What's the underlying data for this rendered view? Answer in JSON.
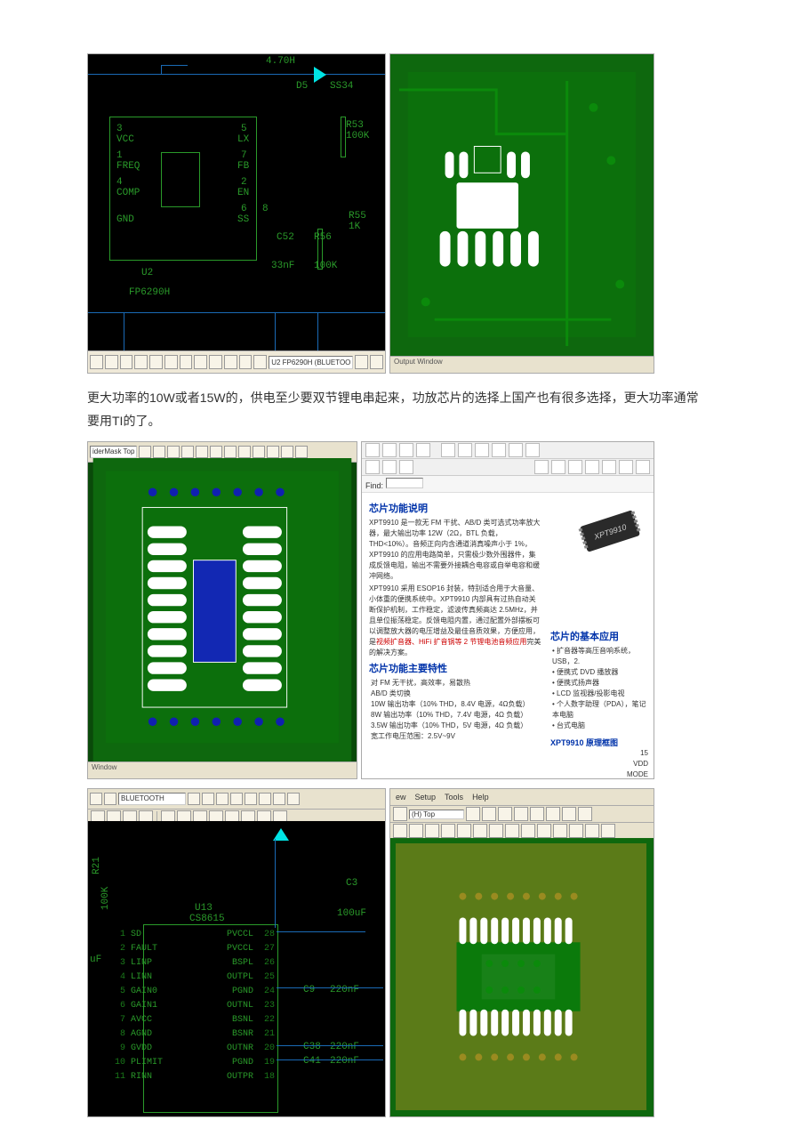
{
  "figure1": {
    "schematic": {
      "top_value": "4.70H",
      "diode_ref": "D5",
      "diode_val": "SS34",
      "ic_ref": "U2",
      "ic_part": "FP6290H",
      "pins_left": [
        "VCC",
        "FREQ",
        "COMP",
        "GND"
      ],
      "pins_left_nums": [
        "3",
        "1",
        "4"
      ],
      "pins_right": [
        "LX",
        "FB",
        "EN",
        "SS"
      ],
      "pins_right_nums": [
        "5",
        "7",
        "2",
        "6",
        "8"
      ],
      "r53_ref": "R53",
      "r53_val": "100K",
      "r55_ref": "R55",
      "r55_val": "1K",
      "c52_ref": "C52",
      "c52_val": "33nF",
      "r56_ref": "R56",
      "r56_val": "100K",
      "toolbar_text": "U2 FP6290H (BLUETOO"
    },
    "pcb": {
      "output_window": "Output Window"
    }
  },
  "body_text": "更大功率的10W或者15W的，供电至少要双节锂电串起来，功放芯片的选择上国产也有很多选择，更大功率通常要用TI的了。",
  "figure2": {
    "pcb_toolbar_label": "iderMask Top",
    "pcb_output": "Window",
    "doc": {
      "find_label": "Find:",
      "h_desc": "芯片功能说明",
      "desc_p1": "XPT9910 是一款无 FM 干扰、AB/D 类可选式功率放大器，最大输出功率 12W（2Ω，BTL 负载，THD<10%）。音频正向内含通道消真噪声小于 1%，XPT9910 的应用电路简单，只需极少数外围器件，集成反馈电阻，输出不需要外接耦合电容或自举电容和缓冲网络。",
      "desc_p2": "XPT9910 采用 ESOP16 封装，特别适合用于大音量、小体重的便携系统中。XPT9910 内部具有过热自动关断保护机制，工作稳定，滤波传真频高达 2.5MHz，并且单位振荡稳定。反馈电阻内置，通过配置外部摆板可以调整放大器的电压增益及最佳音质效果，方便应用，是",
      "desc_red": "视频扩音器、HiFi 扩音锅等 2 节锂电池音频应用",
      "desc_p2b": "完美的解决方案。",
      "h_feat": "芯片功能主要特性",
      "feats": [
        "对 FM 无干扰，高效率，易散热",
        "AB/D 类切换",
        "10W 输出功率（10% THD，8.4V 电源，4Ω负载）",
        "8W 输出功率（10% THD，7.4V 电源，4Ω 负载）",
        "3.5W 输出功率（10% THD，5V 电源，4Ω 负载）",
        "宽工作电压范围：2.5V~9V"
      ],
      "chip_label": "XPT9910",
      "h_app": "芯片的基本应用",
      "apps": [
        "• 扩音器等高压音响系统，USB，2.",
        "• 便携式 DVD 播放器",
        "• 便携式扬声器",
        "• LCD 监视器/投影电视",
        "• 个人数字助理（PDA），笔记本电脑",
        "• 台式电脑"
      ],
      "h_diag": "XPT9910 原理框图",
      "diag_pin": "VDD",
      "diag_pin2": "MODE",
      "diag_num": "15"
    }
  },
  "figure3": {
    "schematic": {
      "dropdown": "BLUETOOTH",
      "r21_ref": "R21",
      "r21_val": "100K",
      "c_left": "uF",
      "ic_ref": "U13",
      "ic_part": "CS8615",
      "c3_ref": "C3",
      "c3_val": "100uF",
      "c9_ref": "C9",
      "c9_val": "220nF",
      "c38_ref": "C38",
      "c38_val": "220nF",
      "c41_ref": "C41",
      "c41_val": "220nF",
      "pins_left": [
        {
          "num": "1",
          "name": "SD"
        },
        {
          "num": "2",
          "name": "FAULT"
        },
        {
          "num": "3",
          "name": "LINP"
        },
        {
          "num": "4",
          "name": "LINN"
        },
        {
          "num": "5",
          "name": "GAIN0"
        },
        {
          "num": "6",
          "name": "GAIN1"
        },
        {
          "num": "7",
          "name": "AVCC"
        },
        {
          "num": "8",
          "name": "AGND"
        },
        {
          "num": "9",
          "name": "GVDD"
        },
        {
          "num": "10",
          "name": "PLIMIT"
        },
        {
          "num": "11",
          "name": "RINN"
        }
      ],
      "pins_right": [
        {
          "num": "28",
          "name": "PVCCL"
        },
        {
          "num": "27",
          "name": "PVCCL"
        },
        {
          "num": "26",
          "name": "BSPL"
        },
        {
          "num": "25",
          "name": "OUTPL"
        },
        {
          "num": "24",
          "name": "PGND"
        },
        {
          "num": "23",
          "name": "OUTNL"
        },
        {
          "num": "22",
          "name": "BSNL"
        },
        {
          "num": "21",
          "name": "BSNR"
        },
        {
          "num": "20",
          "name": "OUTNR"
        },
        {
          "num": "19",
          "name": "PGND"
        },
        {
          "num": "18",
          "name": "OUTPR"
        }
      ]
    },
    "pcb": {
      "menu": [
        "ew",
        "Setup",
        "Tools",
        "Help"
      ],
      "dropdown": "(H) Top"
    }
  }
}
